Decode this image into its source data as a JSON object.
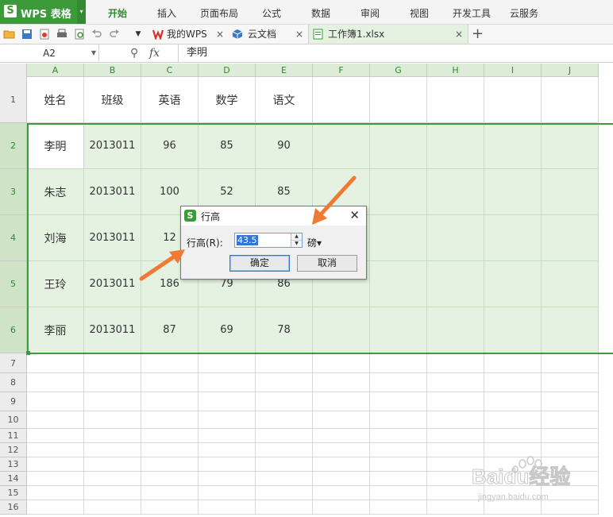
{
  "app": {
    "logo_letter": "S",
    "title": "WPS 表格",
    "dropdown": "▾"
  },
  "menu": [
    "开始",
    "插入",
    "页面布局",
    "公式",
    "数据",
    "审阅",
    "视图",
    "开发工具",
    "云服务"
  ],
  "tabs": [
    {
      "label": "我的WPS",
      "close": "×"
    },
    {
      "label": "云文档",
      "close": "×"
    },
    {
      "label": "工作簿1.xlsx",
      "close": "×"
    }
  ],
  "new_tab": "+",
  "formula_bar": {
    "cell_ref": "A2",
    "zoom_icon": "⚲",
    "fx": "fx",
    "content": "李明"
  },
  "columns": [
    "A",
    "B",
    "C",
    "D",
    "E",
    "F",
    "G",
    "H",
    "I",
    "J"
  ],
  "rows": [
    "1",
    "2",
    "3",
    "4",
    "5",
    "6",
    "7",
    "8",
    "9",
    "10",
    "11",
    "12",
    "13",
    "14",
    "15",
    "16"
  ],
  "cells": [
    [
      "姓名",
      "班级",
      "英语",
      "数学",
      "语文"
    ],
    [
      "李明",
      "2013011",
      "96",
      "85",
      "90"
    ],
    [
      "朱志",
      "2013011",
      "100",
      "52",
      "85"
    ],
    [
      "刘海",
      "2013011",
      "12",
      "",
      ""
    ],
    [
      "王玲",
      "2013011",
      "186",
      "79",
      "86"
    ],
    [
      "李丽",
      "2013011",
      "87",
      "69",
      "78"
    ]
  ],
  "dialog": {
    "title": "行高",
    "close": "✕",
    "label": "行高(R):",
    "value": "43.5",
    "unit": "磅▾",
    "ok": "确定",
    "cancel": "取消"
  },
  "watermark": {
    "text": "Baidu经验",
    "url": "jingyan.baidu.com"
  },
  "colors": {
    "accent": "#3c9a3a",
    "selection": "#e5f2e1",
    "arrow": "#f07a35",
    "dialog_border": "#8a5fb4"
  }
}
